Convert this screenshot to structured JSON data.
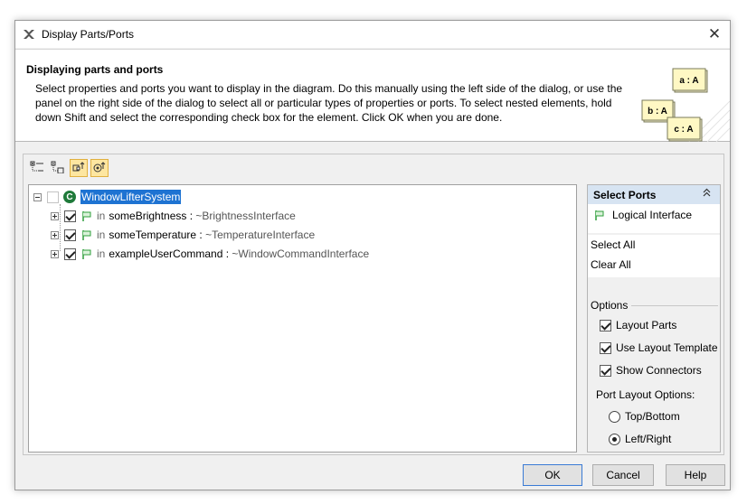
{
  "window": {
    "title": "Display Parts/Ports",
    "close_glyph": "✕"
  },
  "header": {
    "title": "Displaying parts and ports",
    "description": "Select properties and ports you want to display in the diagram. Do this manually using the left side of the dialog, or use the panel on the right side of the dialog to select all or particular types of properties or ports. To select nested elements, hold down Shift and select the corresponding check box for the element. Click OK when you are done.",
    "graphic_labels": [
      "a : A",
      "b : A",
      "c : A"
    ]
  },
  "toolbar": {
    "buttons": [
      {
        "icon": "expand-all-icon",
        "active": false
      },
      {
        "icon": "collapse-all-icon",
        "active": false
      },
      {
        "icon": "show-ports-icon",
        "active": true
      },
      {
        "icon": "show-parts-icon",
        "active": true
      }
    ]
  },
  "tree": {
    "root": {
      "label": "WindowLifterSystem",
      "icon": "class-icon",
      "icon_letter": "C",
      "checked": false,
      "selected": true
    },
    "children": [
      {
        "keyword": "in",
        "name": "someBrightness",
        "separator": " : ",
        "type": "~BrightnessInterface",
        "checked": true
      },
      {
        "keyword": "in",
        "name": "someTemperature",
        "separator": " : ",
        "type": "~TemperatureInterface",
        "checked": true
      },
      {
        "keyword": "in",
        "name": "exampleUserCommand",
        "separator": " : ",
        "type": "~WindowCommandInterface",
        "checked": true
      }
    ]
  },
  "right_panel": {
    "header": "Select Ports",
    "collapse_glyph": "≈",
    "port_types": [
      {
        "label": "Logical Interface",
        "icon": "port-icon"
      }
    ],
    "select_all": "Select All",
    "clear_all": "Clear All",
    "options_label": "Options",
    "options": [
      {
        "label": "Layout Parts",
        "checked": true
      },
      {
        "label": "Use Layout Template",
        "checked": true
      },
      {
        "label": "Show Connectors",
        "checked": true
      }
    ],
    "port_layout_label": "Port Layout Options:",
    "port_layout_options": [
      {
        "label": "Top/Bottom",
        "selected": false
      },
      {
        "label": "Left/Right",
        "selected": true
      }
    ]
  },
  "buttons": {
    "ok": "OK",
    "cancel": "Cancel",
    "help": "Help"
  },
  "colors": {
    "selection": "#1e73d2",
    "panel_header": "#d7e4f2",
    "active_toolbar": "#fde6a0",
    "port_green": "#2e9e3a",
    "class_green": "#1f7a3a",
    "note_yellow": "#fff8c4"
  }
}
